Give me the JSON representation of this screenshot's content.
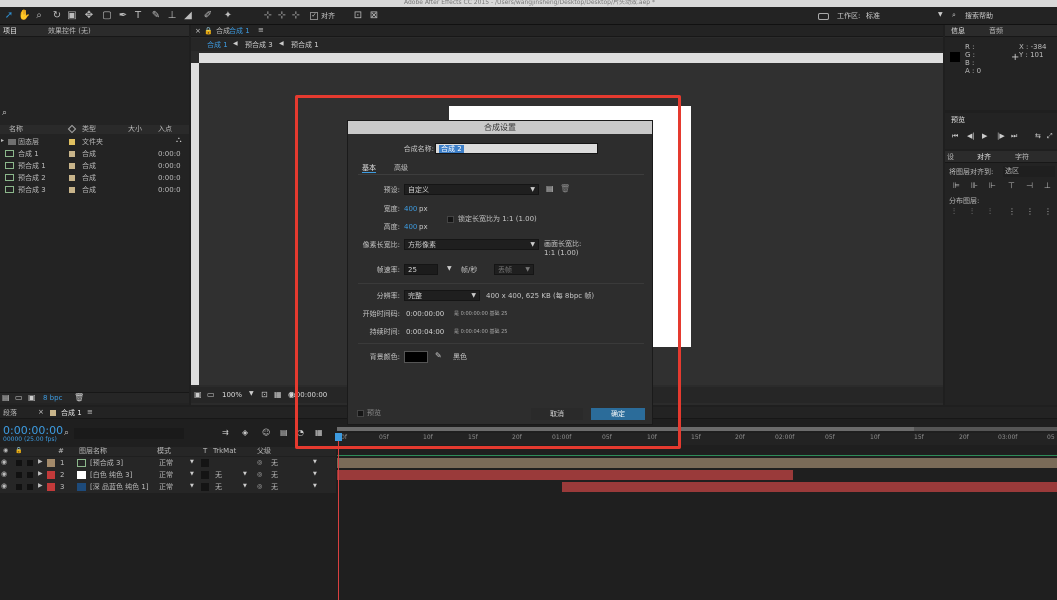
{
  "window": {
    "title": "Adobe After Effects CC 2015 - /Users/wangjinsheng/Desktop/Desktop/片头动效.aep *"
  },
  "toolbar": {
    "snap_label": "对齐",
    "workspace_label": "工作区:",
    "workspace_value": "标准",
    "search_placeholder": "搜索帮助"
  },
  "project_panel": {
    "tab_project": "项目",
    "tab_effects": "效果控件 (无)",
    "search_icon": "⌕",
    "col_name": "名称",
    "col_type": "类型",
    "col_size": "大小",
    "col_in": "入点",
    "items": [
      {
        "name": "固态层",
        "type": "文件夹",
        "in": "",
        "color": "#e0c060",
        "icon": "▸"
      },
      {
        "name": "合成 1",
        "type": "合成",
        "in": "0:00:0",
        "color": "#c8b48a",
        "icon": "▦"
      },
      {
        "name": "预合成 1",
        "type": "合成",
        "in": "0:00:0",
        "color": "#c8b48a",
        "icon": "▦"
      },
      {
        "name": "预合成 2",
        "type": "合成",
        "in": "0:00:0",
        "color": "#c8b48a",
        "icon": "▦"
      },
      {
        "name": "预合成 3",
        "type": "合成",
        "in": "0:00:0",
        "color": "#c8b48a",
        "icon": "▦"
      }
    ],
    "bpc": "8 bpc"
  },
  "comp_panel": {
    "tab_prefix": "合成",
    "tab_name": "合成 1",
    "breadcrumbs": [
      "合成 1",
      "预合成 3",
      "预合成 1"
    ],
    "ruler": [
      "400",
      "350",
      "300",
      "250",
      "200",
      "150",
      "100",
      "50",
      "0",
      "50",
      "100",
      "150",
      "200",
      "250",
      "300",
      "350",
      "400",
      "450",
      "500",
      "550",
      "600",
      "650",
      "700",
      "750",
      "800"
    ],
    "zoom": "100%",
    "timecode": "0:00:00:00"
  },
  "info_panel": {
    "tab_info": "信息",
    "tab_audio": "音频",
    "r": "R :",
    "g": "G :",
    "b": "B :",
    "a": "A : 0",
    "x": "X : -384",
    "y": "Y : 101"
  },
  "preview_panel": {
    "title": "预览"
  },
  "align_panel": {
    "tab_left": "设",
    "tab_align": "对齐",
    "tab_char": "字符",
    "align_to_label": "将图层对齐到:",
    "align_to_value": "选区",
    "distribute_label": "分布图层:"
  },
  "dialog": {
    "title": "合成设置",
    "comp_name_label": "合成名称:",
    "comp_name_value": "合成 2",
    "tab_basic": "基本",
    "tab_advanced": "高级",
    "preset_label": "预设:",
    "preset_value": "自定义",
    "width_label": "宽度:",
    "width_value": "400",
    "width_unit": "px",
    "lock_label": "锁定长宽比为 1:1 (1.00)",
    "height_label": "高度:",
    "height_value": "400",
    "height_unit": "px",
    "par_label": "像素长宽比:",
    "par_value": "方形像素",
    "frame_ar_label": "画面长宽比:",
    "frame_ar_value": "1:1 (1.00)",
    "fps_label": "帧速率:",
    "fps_value": "25",
    "fps_unit": "帧/秒",
    "drop_value": "丢帧",
    "res_label": "分辨率:",
    "res_value": "完整",
    "res_info": "400 x 400, 625 KB (每 8bpc 帧)",
    "start_label": "开始时间码:",
    "start_value": "0:00:00:00",
    "start_info": "是 0:00:00:00  基础 25",
    "duration_label": "持续时间:",
    "duration_value": "0:00:04:00",
    "duration_info": "是 0:00:04:00  基础 25",
    "bg_label": "背景颜色:",
    "bg_name": "黑色",
    "preview_label": "预览",
    "cancel": "取消",
    "ok": "确定",
    "accent": "#e53a2f"
  },
  "timeline": {
    "tab_render": "渲染队列",
    "tab_render_short": "段落",
    "tab_comp": "合成 1",
    "current_time": "0:00:00:00",
    "fps_info": "00000 (25.00 fps)",
    "col_num": "#",
    "col_layer": "图层名称",
    "col_mode": "模式",
    "col_t": "T",
    "col_trkmat": "TrkMat",
    "col_parent": "父级",
    "ruler": [
      "0f",
      "05f",
      "10f",
      "15f",
      "20f",
      "01:00f",
      "05f",
      "10f",
      "15f",
      "20f",
      "02:00f",
      "05f",
      "10f",
      "15f",
      "20f",
      "03:00f",
      "05"
    ],
    "layers": [
      {
        "num": "1",
        "name": "[预合成 3]",
        "mode": "正常",
        "trkmat": "",
        "parent": "无",
        "color": "#a38a6a"
      },
      {
        "num": "2",
        "name": "[白色 纯色 3]",
        "mode": "正常",
        "trkmat": "无",
        "parent": "无",
        "color": "#c23a3a"
      },
      {
        "num": "3",
        "name": "[深 品蓝色 纯色 1]",
        "mode": "正常",
        "trkmat": "无",
        "parent": "无",
        "color": "#c23a3a"
      }
    ]
  }
}
